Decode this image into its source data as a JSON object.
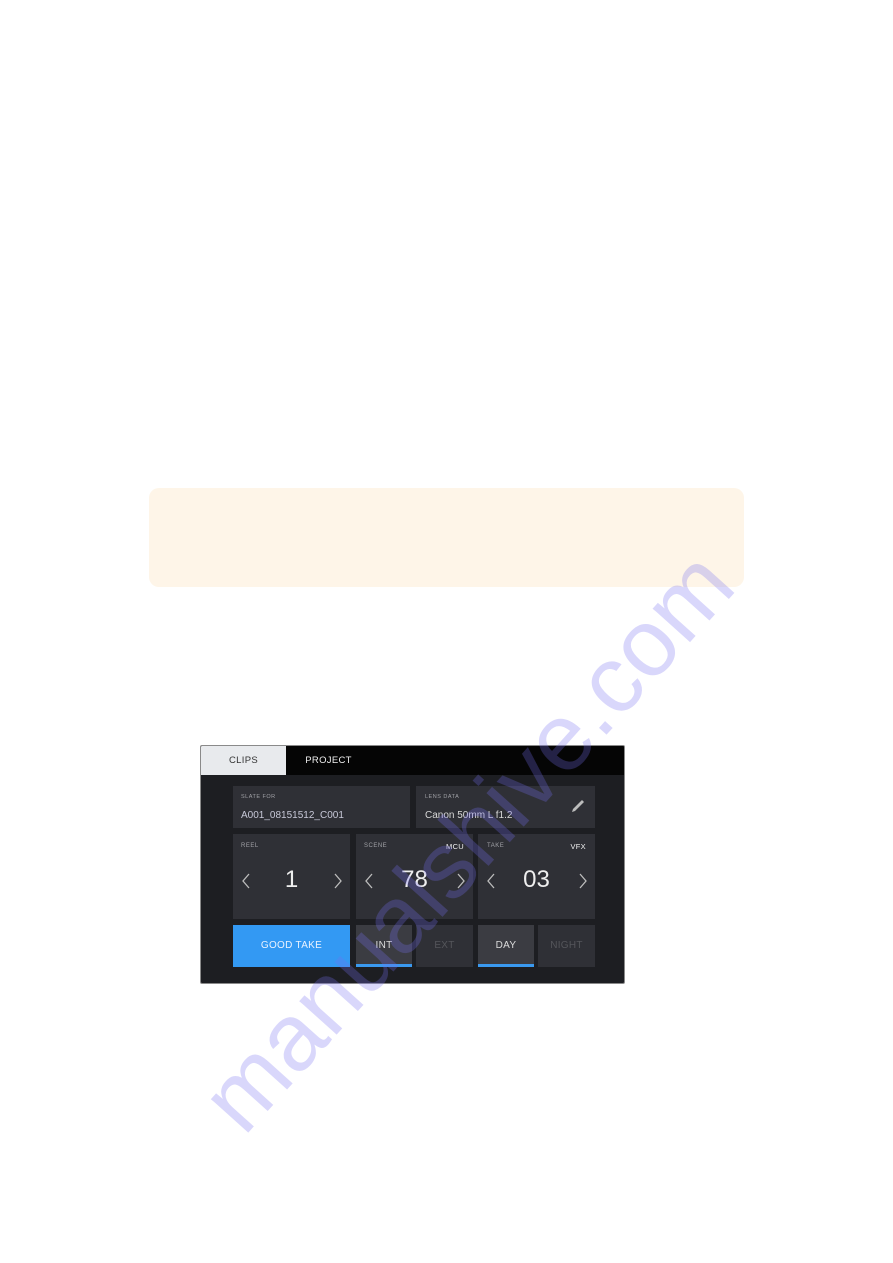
{
  "tabs": [
    {
      "label": "CLIPS",
      "active": true
    },
    {
      "label": "PROJECT",
      "active": false
    }
  ],
  "slate_for": {
    "label": "SLATE FOR",
    "value": "A001_08151512_C001"
  },
  "lens_data": {
    "label": "LENS DATA",
    "value": "Canon 50mm L f1.2",
    "icon": "pencil-icon"
  },
  "reel": {
    "label": "REEL",
    "value": "1"
  },
  "scene": {
    "label": "SCENE",
    "tag": "MCU",
    "value": "78"
  },
  "take": {
    "label": "TAKE",
    "tag": "VFX",
    "value": "03"
  },
  "buttons": {
    "good_take": "GOOD TAKE",
    "int": "INT",
    "ext": "EXT",
    "day": "DAY",
    "night": "NIGHT"
  },
  "selected": {
    "int_ext": "INT",
    "day_night": "DAY",
    "good_take": true
  },
  "colors": {
    "accent": "#3a99ef",
    "panel": "#1d1e22",
    "cell": "#2f3036",
    "note_box": "#fef5e8"
  },
  "watermark": "manualshive.com"
}
